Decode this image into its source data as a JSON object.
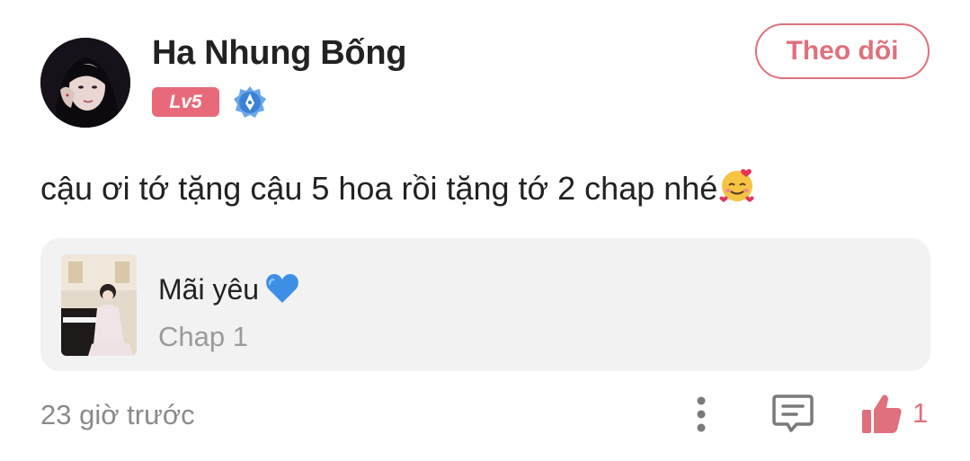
{
  "comment": {
    "user": {
      "name": "Ha Nhung Bống",
      "level": "Lv5",
      "follow_label": "Theo dõi"
    },
    "text": "cậu ơi tớ tặng cậu 5 hoa rồi tặng tớ 2 chap nhé",
    "text_emoji": "smiling-face-with-hearts",
    "story": {
      "title": "Mãi yêu",
      "title_emoji": "blue-heart",
      "chapter": "Chap 1"
    },
    "timestamp": "23 giờ trước",
    "likes": "1"
  },
  "colors": {
    "accent": "#e0707c",
    "level_badge": "#e86a7a",
    "card_bg": "#f2f2f3",
    "rank_icon": "#3b82d6"
  }
}
